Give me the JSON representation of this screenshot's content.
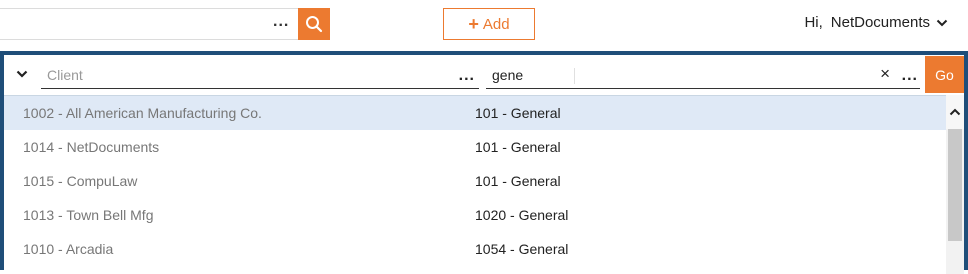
{
  "header": {
    "search_value": "",
    "search_more": "...",
    "add_label": "Add",
    "add_plus": "+",
    "greeting": "Hi,",
    "user_name": "NetDocuments"
  },
  "filter": {
    "client_placeholder": "Client",
    "client_value": "",
    "more_label": "...",
    "matter_value": "gene",
    "clear_label": "×",
    "go_label": "Go"
  },
  "results": [
    {
      "client": "1002 - All American Manufacturing Co.",
      "matter": "101 - General",
      "selected": true
    },
    {
      "client": "1014 - NetDocuments",
      "matter": "101 - General",
      "selected": false
    },
    {
      "client": "1015 - CompuLaw",
      "matter": "101 - General",
      "selected": false
    },
    {
      "client": "1013 - Town Bell Mfg",
      "matter": "1020 - General",
      "selected": false
    },
    {
      "client": "1010 - Arcadia",
      "matter": "1054 - General",
      "selected": false
    }
  ],
  "colors": {
    "accent": "#ec7a30",
    "panel_border": "#1f4e79",
    "selected_row": "#dfe9f6"
  },
  "icons": {
    "search": "search-icon",
    "dropdown": "chevron-down-icon",
    "scroll_up": "chevron-up-icon"
  }
}
